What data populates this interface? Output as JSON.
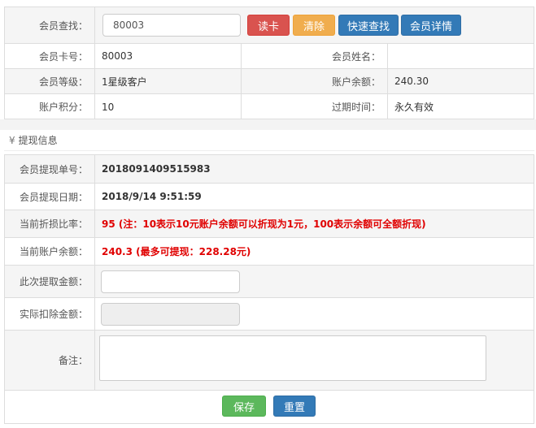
{
  "member": {
    "search_label": "会员查找：",
    "search_value": "80003",
    "buttons": {
      "read_card": "读卡",
      "clear": "清除",
      "quick_search": "快速查找",
      "details": "会员详情"
    },
    "rows": [
      {
        "l1": "会员卡号：",
        "v1": "80003",
        "l2": "会员姓名：",
        "v2": ""
      },
      {
        "l1": "会员等级：",
        "v1": "1星级客户",
        "l2": "账户余额：",
        "v2": "240.30"
      },
      {
        "l1": "账户积分：",
        "v1": "10",
        "l2": "过期时间：",
        "v2": "永久有效"
      }
    ]
  },
  "withdraw": {
    "section_icon": "¥",
    "section_title": "提现信息",
    "order_label": "会员提现单号：",
    "order_value": "2018091409515983",
    "date_label": "会员提现日期：",
    "date_value": "2018/9/14 9:51:59",
    "rate_label": "当前折损比率：",
    "rate_value": "95 (注：10表示10元账户余额可以折现为1元，100表示余额可全额折现)",
    "balance_label": "当前账户余额：",
    "balance_value": "240.3 (最多可提现：228.28元)",
    "amount_label": "此次提取金额：",
    "amount_value": "",
    "deduct_label": "实际扣除金额：",
    "deduct_value": "",
    "note_label": "备注：",
    "note_value": "",
    "save": "保存",
    "reset": "重置"
  },
  "colors": {
    "danger": "#d9534f",
    "warning": "#f0ad4e",
    "primary": "#337ab7",
    "success": "#5cb85c",
    "highlight": "#e00000"
  }
}
